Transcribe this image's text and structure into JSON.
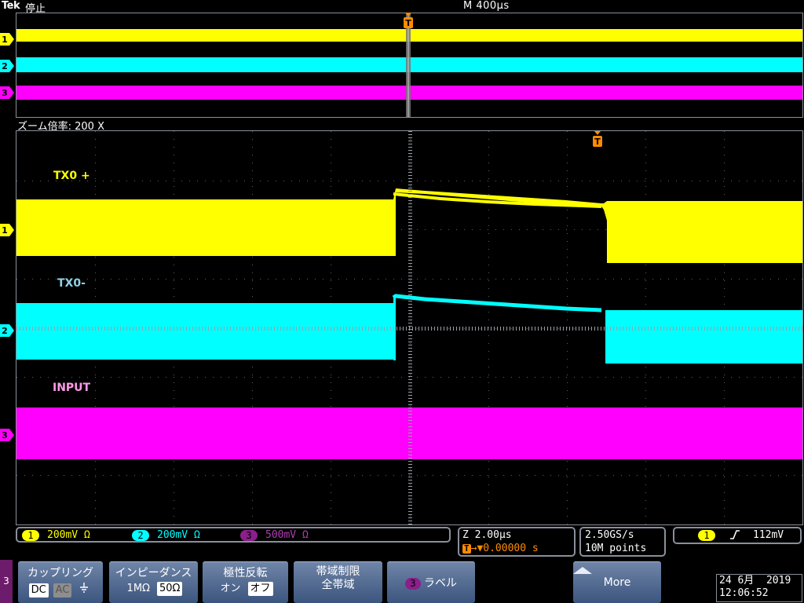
{
  "header": {
    "brand": "Tek",
    "run_state": "停止",
    "timebase": "M 400µs"
  },
  "zoom": {
    "label": "ズーム倍率: 200 X"
  },
  "trigger_marker": "T",
  "waveform_labels": {
    "tx0_plus": "TX0 +",
    "tx0_minus": "TX0-",
    "input": "INPUT"
  },
  "channel_markers": [
    "1",
    "2",
    "3"
  ],
  "channels": [
    {
      "number": "1",
      "scale": "200mV",
      "impedance": "Ω",
      "color": "#ffff00"
    },
    {
      "number": "2",
      "scale": "200mV",
      "impedance": "Ω",
      "color": "#00ffff"
    },
    {
      "number": "3",
      "scale": "500mV",
      "impedance": "Ω",
      "color": "#ff00ff"
    }
  ],
  "zoom_readout": {
    "zoom_scale": "Z 2.00µs",
    "trigger_pos_icon": "T",
    "trigger_offset": "0.00000 s"
  },
  "sample_readout": {
    "rate": "2.50GS/s",
    "points": "10M points"
  },
  "trigger_readout": {
    "source": "1",
    "slope_icon": "rising-edge-icon",
    "level": "112mV"
  },
  "menu": {
    "channel_tab": "3",
    "coupling": {
      "title": "カップリング",
      "options": [
        "DC",
        "AC"
      ],
      "ground_icon": "ground-icon",
      "selected": "DC"
    },
    "impedance": {
      "title": "インピーダンス",
      "options": [
        "1MΩ",
        "50Ω"
      ],
      "selected": "50Ω"
    },
    "invert": {
      "title": "極性反転",
      "options": [
        "オン",
        "オフ"
      ],
      "selected": "オフ"
    },
    "bandwidth": {
      "title": "帯域制限",
      "value": "全帯域"
    },
    "label": {
      "channel": "3",
      "title": "ラベル"
    },
    "more": {
      "title": "More",
      "arrow_icon": "up-arrow-icon"
    }
  },
  "datetime": {
    "date": "24 6月  2019",
    "time": "12:06:52"
  },
  "colors": {
    "ch1": "#ffff00",
    "ch2": "#00ffff",
    "ch3": "#ff00ff",
    "trigger": "#ff8c00",
    "grid": "#8a8f9a"
  }
}
